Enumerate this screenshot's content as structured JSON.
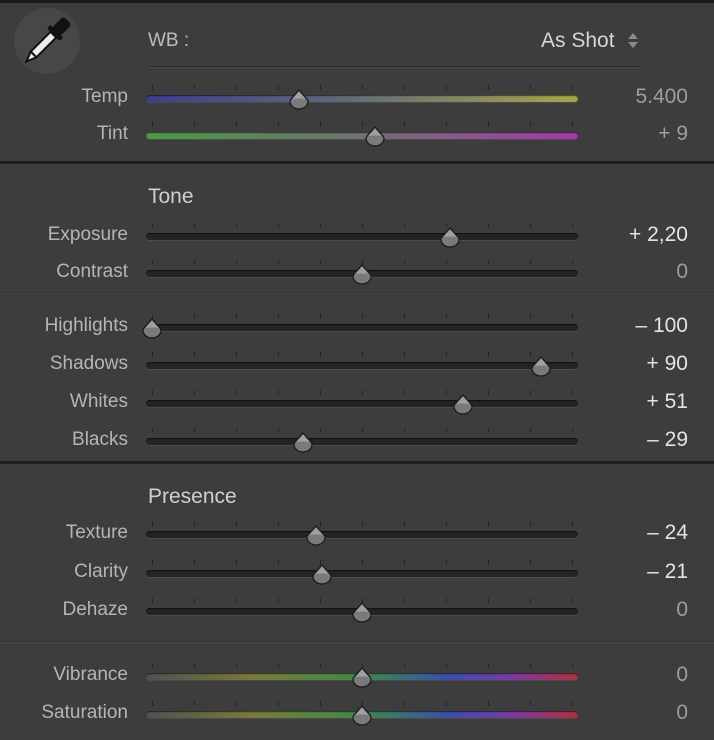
{
  "wb": {
    "label": "WB :",
    "value": "As Shot",
    "eyedropper_icon": "eyedropper-icon",
    "arrows_icon": "up-down-arrows-icon"
  },
  "sections": {
    "tone": "Tone",
    "presence": "Presence"
  },
  "sliders": [
    {
      "key": "temp",
      "label": "Temp",
      "value": "5.400",
      "position": 0.35,
      "dim": true,
      "track": "linear-gradient(90deg,#3b3f8c,#5f6a78 45%,#a8a44a 100%)"
    },
    {
      "key": "tint",
      "label": "Tint",
      "value": "+ 9",
      "position": 0.53,
      "dim": true,
      "track": "linear-gradient(90deg,#4b9a47,#707070 50%,#a33aa6 100%)"
    },
    {
      "key": "exposure",
      "label": "Exposure",
      "value": "+ 2,20",
      "position": 0.71,
      "dim": false,
      "track": ""
    },
    {
      "key": "contrast",
      "label": "Contrast",
      "value": "0",
      "position": 0.5,
      "dim": true,
      "track": ""
    },
    {
      "key": "highlights",
      "label": "Highlights",
      "value": "– 100",
      "position": 0.0,
      "dim": false,
      "track": ""
    },
    {
      "key": "shadows",
      "label": "Shadows",
      "value": "+ 90",
      "position": 0.925,
      "dim": false,
      "track": ""
    },
    {
      "key": "whites",
      "label": "Whites",
      "value": "+ 51",
      "position": 0.74,
      "dim": false,
      "track": ""
    },
    {
      "key": "blacks",
      "label": "Blacks",
      "value": "– 29",
      "position": 0.36,
      "dim": false,
      "track": ""
    },
    {
      "key": "texture",
      "label": "Texture",
      "value": "– 24",
      "position": 0.39,
      "dim": false,
      "track": ""
    },
    {
      "key": "clarity",
      "label": "Clarity",
      "value": "– 21",
      "position": 0.405,
      "dim": false,
      "track": ""
    },
    {
      "key": "dehaze",
      "label": "Dehaze",
      "value": "0",
      "position": 0.5,
      "dim": true,
      "track": ""
    },
    {
      "key": "vibrance",
      "label": "Vibrance",
      "value": "0",
      "position": 0.5,
      "dim": true,
      "track": "linear-gradient(90deg,#505050,#7a7a3a 25%,#3e8a4a 50%,#3b4fa8 70%,#7b3aa0 85%,#b0313a 100%)"
    },
    {
      "key": "saturation",
      "label": "Saturation",
      "value": "0",
      "position": 0.5,
      "dim": true,
      "track": "linear-gradient(90deg,#505050,#7a7a3a 25%,#3e8a4a 50%,#3b4fa8 70%,#7b3aa0 85%,#b0313a 100%)"
    }
  ]
}
